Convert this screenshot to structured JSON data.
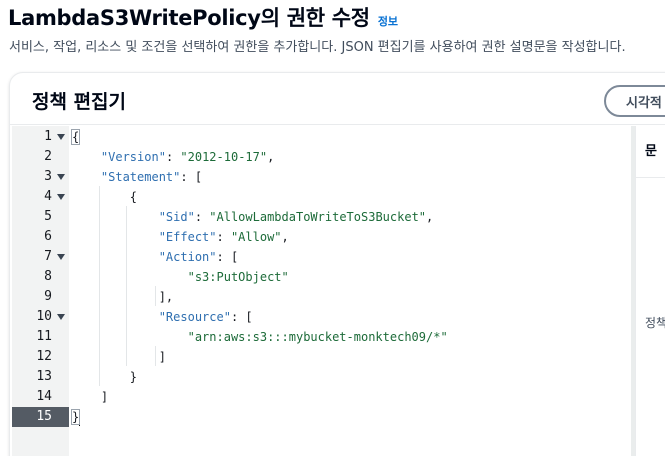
{
  "header": {
    "title": "LambdaS3WritePolicy의 권한 수정",
    "info_link": "정보",
    "description": "서비스, 작업, 리소스 및 조건을 선택하여 권한을 추가합니다. JSON 편집기를 사용하여 권한 설명문을 작성합니다."
  },
  "editor": {
    "title": "정책 편집기",
    "visual_button": "시각적",
    "active_line": 15,
    "lines": [
      {
        "n": "1",
        "fold": true,
        "parts": [
          {
            "t": "{"
          }
        ]
      },
      {
        "n": "2",
        "fold": false,
        "parts": [
          {
            "t": "    "
          },
          {
            "k": "\"Version\""
          },
          {
            "t": ": "
          },
          {
            "s": "\"2012-10-17\""
          },
          {
            "t": ","
          }
        ]
      },
      {
        "n": "3",
        "fold": true,
        "parts": [
          {
            "t": "    "
          },
          {
            "k": "\"Statement\""
          },
          {
            "t": ": ["
          }
        ]
      },
      {
        "n": "4",
        "fold": true,
        "parts": [
          {
            "t": "        {"
          }
        ]
      },
      {
        "n": "5",
        "fold": false,
        "parts": [
          {
            "t": "            "
          },
          {
            "k": "\"Sid\""
          },
          {
            "t": ": "
          },
          {
            "s": "\"AllowLambdaToWriteToS3Bucket\""
          },
          {
            "t": ","
          }
        ]
      },
      {
        "n": "6",
        "fold": false,
        "parts": [
          {
            "t": "            "
          },
          {
            "k": "\"Effect\""
          },
          {
            "t": ": "
          },
          {
            "s": "\"Allow\""
          },
          {
            "t": ","
          }
        ]
      },
      {
        "n": "7",
        "fold": true,
        "parts": [
          {
            "t": "            "
          },
          {
            "k": "\"Action\""
          },
          {
            "t": ": ["
          }
        ]
      },
      {
        "n": "8",
        "fold": false,
        "parts": [
          {
            "t": "                "
          },
          {
            "s": "\"s3:PutObject\""
          }
        ]
      },
      {
        "n": "9",
        "fold": false,
        "parts": [
          {
            "t": "            ],"
          }
        ]
      },
      {
        "n": "10",
        "fold": true,
        "parts": [
          {
            "t": "            "
          },
          {
            "k": "\"Resource\""
          },
          {
            "t": ": ["
          }
        ]
      },
      {
        "n": "11",
        "fold": false,
        "parts": [
          {
            "t": "                "
          },
          {
            "s": "\"arn:aws:s3:::mybucket-monktech09/*\""
          }
        ]
      },
      {
        "n": "12",
        "fold": false,
        "parts": [
          {
            "t": "            ]"
          }
        ]
      },
      {
        "n": "13",
        "fold": false,
        "parts": [
          {
            "t": "        }"
          }
        ]
      },
      {
        "n": "14",
        "fold": false,
        "parts": [
          {
            "t": "    ]"
          }
        ]
      },
      {
        "n": "15",
        "fold": false,
        "parts": [
          {
            "t": "}"
          }
        ]
      }
    ]
  },
  "side_panel": {
    "title": "문",
    "text": "정책"
  }
}
